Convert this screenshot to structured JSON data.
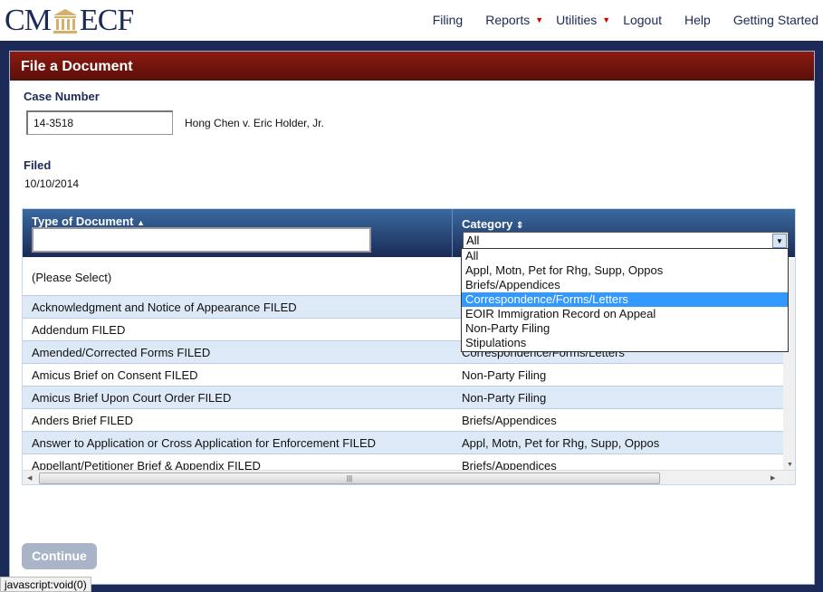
{
  "header": {
    "logo": "CM/ECF",
    "nav": [
      {
        "label": "Filing",
        "dropdown": false
      },
      {
        "label": "Reports",
        "dropdown": true
      },
      {
        "label": "Utilities",
        "dropdown": true
      },
      {
        "label": "Logout",
        "dropdown": false
      },
      {
        "label": "Help",
        "dropdown": false
      },
      {
        "label": "Getting Started",
        "dropdown": false
      }
    ]
  },
  "page": {
    "title": "File a Document",
    "case_number_label": "Case Number",
    "case_number": "14-3518",
    "case_title": "Hong Chen v. Eric Holder, Jr.",
    "filed_label": "Filed",
    "filed_date": "10/10/2014",
    "continue_label": "Continue"
  },
  "grid": {
    "col_type": "Type of Document",
    "col_category": "Category",
    "type_filter": "",
    "category_selected": "All",
    "rows": [
      {
        "doc": "(Please Select)",
        "cat": ""
      },
      {
        "doc": "Acknowledgment and Notice of Appearance FILED",
        "cat": ""
      },
      {
        "doc": "Addendum FILED",
        "cat": ""
      },
      {
        "doc": "Amended/Corrected Forms FILED",
        "cat": "Correspondence/Forms/Letters"
      },
      {
        "doc": "Amicus Brief on Consent FILED",
        "cat": "Non-Party Filing"
      },
      {
        "doc": "Amicus Brief Upon Court Order FILED",
        "cat": "Non-Party Filing"
      },
      {
        "doc": "Anders Brief FILED",
        "cat": "Briefs/Appendices"
      },
      {
        "doc": "Answer to Application or Cross Application for Enforcement FILED",
        "cat": "Appl, Motn, Pet for Rhg, Supp, Oppos"
      },
      {
        "doc": "Appellant/Petitioner Brief & Appendix FILED",
        "cat": "Briefs/Appendices"
      }
    ]
  },
  "category_dropdown": {
    "options": [
      "All",
      "Appl, Motn, Pet for Rhg, Supp, Oppos",
      "Briefs/Appendices",
      "Correspondence/Forms/Letters",
      "EOIR Immigration Record on Appeal",
      "Non-Party Filing",
      "Stipulations"
    ],
    "highlighted": "Correspondence/Forms/Letters"
  },
  "status_bar": "javascript:void(0)",
  "colors": {
    "navy": "#1b2a56",
    "title_red": "#7a140d",
    "highlight": "#3399ff",
    "nav_caret": "#d40000"
  }
}
